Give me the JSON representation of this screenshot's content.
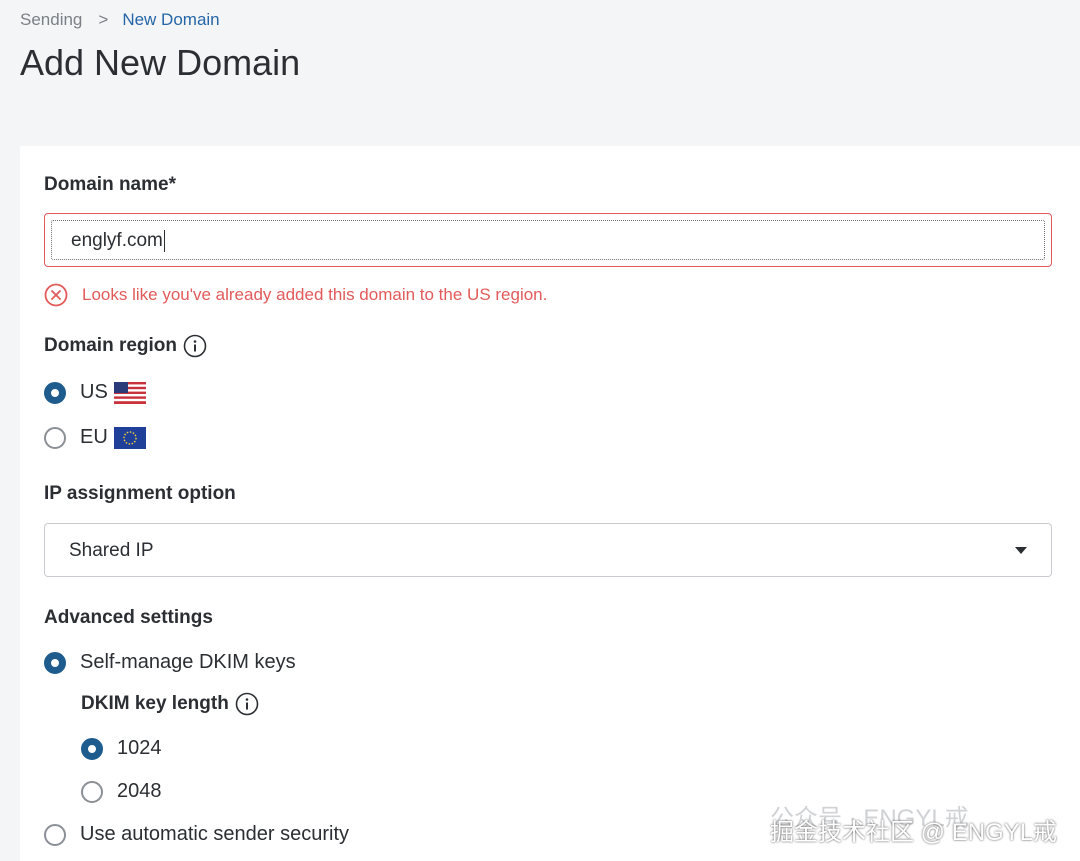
{
  "breadcrumb": {
    "parent": "Sending",
    "separator": ">",
    "current": "New Domain"
  },
  "page_title": "Add New Domain",
  "form": {
    "domain_name": {
      "label": "Domain name*",
      "value": "englyf.com",
      "error": "Looks like you've already added this domain to the US region."
    },
    "domain_region": {
      "label": "Domain region",
      "options": [
        {
          "label": "US",
          "selected": true
        },
        {
          "label": "EU",
          "selected": false
        }
      ]
    },
    "ip_assignment": {
      "label": "IP assignment option",
      "selected": "Shared IP"
    },
    "advanced": {
      "label": "Advanced settings",
      "self_manage": {
        "label": "Self-manage DKIM keys",
        "selected": true
      },
      "dkim_key_length": {
        "label": "DKIM key length",
        "options": [
          {
            "label": "1024",
            "selected": true
          },
          {
            "label": "2048",
            "selected": false
          }
        ]
      },
      "automatic": {
        "label": "Use automatic sender security",
        "selected": false
      }
    }
  },
  "watermark": {
    "line1": "公众号 · ENGYL戒",
    "line2": "掘金技术社区 @ ENGYL戒"
  },
  "colors": {
    "accent": "#1e5c8e",
    "link": "#2566a8",
    "error": "#e25a5a"
  },
  "icons": [
    "chevron-right-icon",
    "error-circle-icon",
    "info-icon",
    "us-flag-icon",
    "eu-flag-icon",
    "dropdown-caret-icon"
  ]
}
